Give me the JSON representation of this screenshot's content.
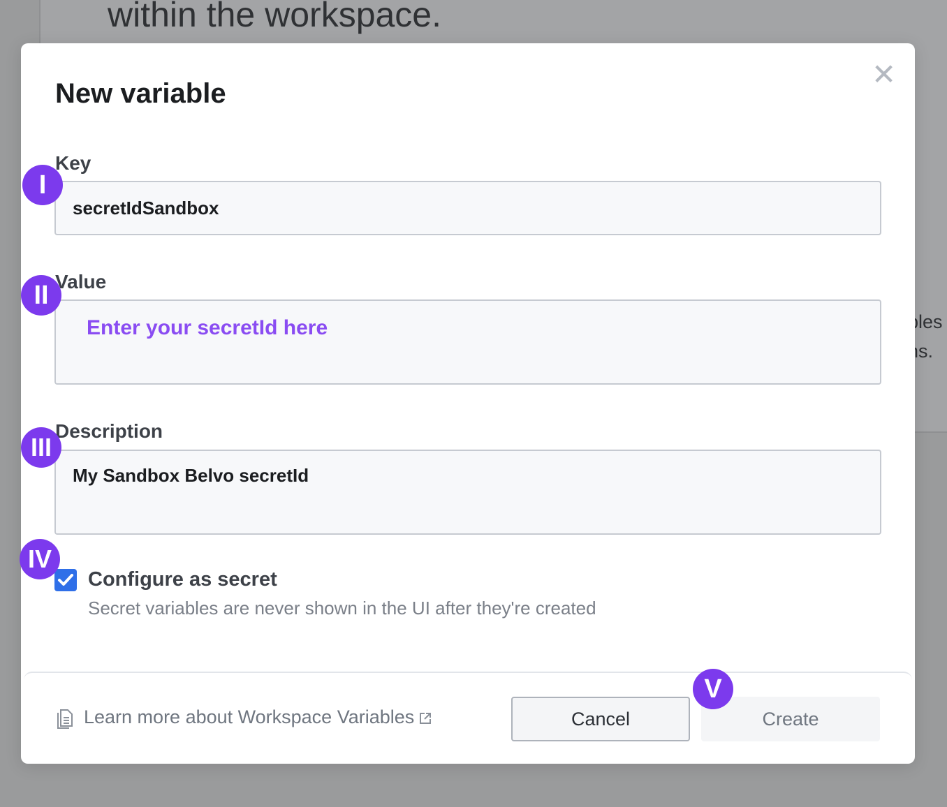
{
  "background": {
    "heading": "within the workspace.",
    "side_text_line1": "bles",
    "side_text_line2": "ns."
  },
  "modal": {
    "title": "New variable",
    "close_icon": "close-icon",
    "fields": {
      "key": {
        "label": "Key",
        "value": "secretIdSandbox"
      },
      "value": {
        "label": "Value",
        "placeholder": "Enter your secretId here"
      },
      "description": {
        "label": "Description",
        "value": "My Sandbox Belvo secretId"
      }
    },
    "secret": {
      "checked": true,
      "label": "Configure as secret",
      "help": "Secret variables are never shown in the UI after they're created"
    },
    "footer": {
      "learn_more": "Learn more about Workspace Variables",
      "doc_icon": "document-icon",
      "external_icon": "external-link-icon",
      "cancel_label": "Cancel",
      "create_label": "Create"
    }
  },
  "badges": [
    "I",
    "II",
    "III",
    "IV",
    "V"
  ],
  "colors": {
    "badge": "#7c3aed",
    "placeholder": "#8a4cf2",
    "checkbox": "#2f6fe8"
  }
}
